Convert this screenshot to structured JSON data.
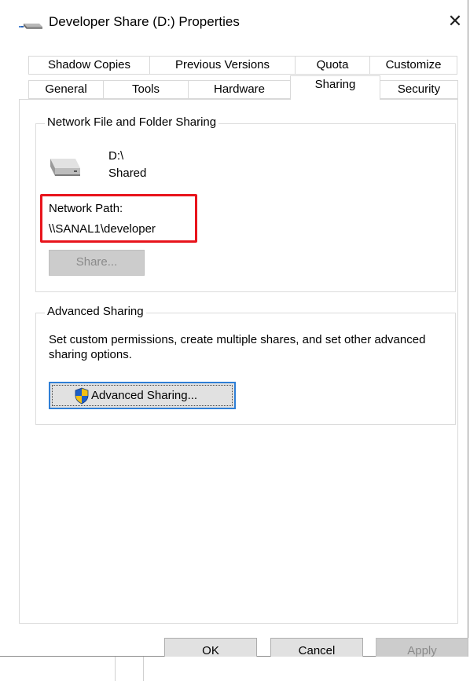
{
  "window": {
    "title": "Developer Share (D:) Properties",
    "close_symbol": "✕"
  },
  "tabs": {
    "row_back": [
      "Shadow Copies",
      "Previous Versions",
      "Quota",
      "Customize"
    ],
    "row_front": [
      "General",
      "Tools",
      "Hardware",
      "Sharing",
      "Security"
    ],
    "selected": "Sharing"
  },
  "network_sharing": {
    "group_label": "Network File and Folder Sharing",
    "drive_name": "D:\\",
    "drive_status": "Shared",
    "network_path_label": "Network Path:",
    "network_path_value": "\\\\SANAL1\\developer",
    "share_button": "Share...",
    "share_button_enabled": false
  },
  "advanced_sharing": {
    "group_label": "Advanced Sharing",
    "description": "Set custom permissions, create multiple shares, and set other advanced sharing options.",
    "button_label": "Advanced Sharing..."
  },
  "footer": {
    "ok": "OK",
    "cancel": "Cancel",
    "apply": "Apply",
    "apply_enabled": false
  },
  "colors": {
    "highlight_border": "#e8141c",
    "focus_border": "#2f7fd6",
    "shield_blue": "#1e5fc6",
    "shield_yellow": "#f3c014"
  }
}
